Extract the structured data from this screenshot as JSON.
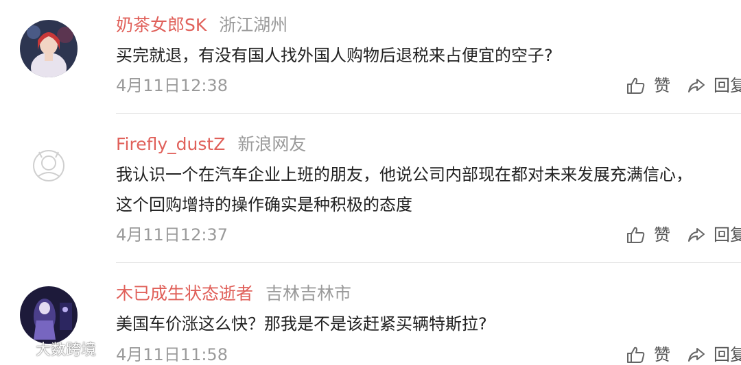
{
  "comments": [
    {
      "username": "奶茶女郎SK",
      "location": "浙江湖州",
      "lines": [
        "买完就退，有没有国人找外国人购物后退税来占便宜的空子?"
      ],
      "time": "4月11日12:38",
      "like_label": "赞",
      "reply_label": "回复"
    },
    {
      "username": "Firefly_dustZ",
      "location": "新浪网友",
      "lines": [
        "我认识一个在汽车企业上班的朋友，他说公司内部现在都对未来发展充满信心，",
        "这个回购增持的操作确实是种积极的态度"
      ],
      "time": "4月11日12:37",
      "like_label": "赞",
      "reply_label": "回复"
    },
    {
      "username": "木已成生状态逝者",
      "location": "吉林吉林市",
      "lines": [
        "美国车价涨这么快？那我是不是该赶紧买辆特斯拉?"
      ],
      "time": "4月11日11:58",
      "like_label": "赞",
      "reply_label": "回复"
    }
  ],
  "watermark": {
    "text": "大数跨境",
    "icon": "weibo-logo-icon"
  },
  "colors": {
    "username": "#e0605a",
    "secondary_text": "#9a9a9a",
    "body_text": "#222222",
    "divider": "#e4e4e4"
  }
}
